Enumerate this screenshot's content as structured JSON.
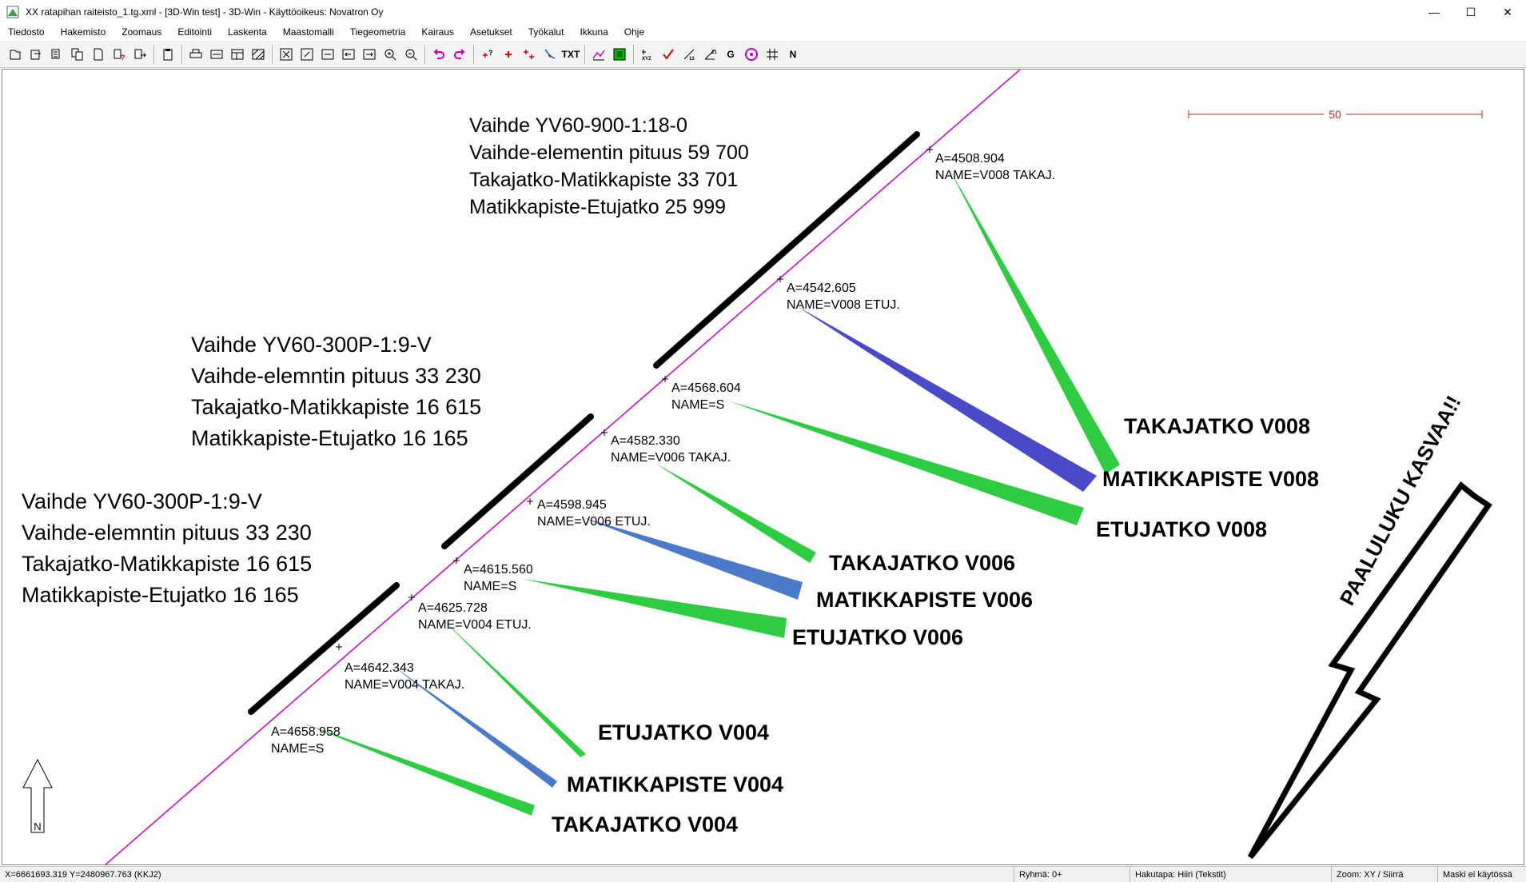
{
  "window": {
    "title": "XX ratapihan raiteisto_1.tg.xml - [3D-Win test] - 3D-Win - Käyttöoikeus: Novatron Oy",
    "minimize": "—",
    "maximize": "☐",
    "close": "✕"
  },
  "menu": [
    "Tiedosto",
    "Hakemisto",
    "Zoomaus",
    "Editointi",
    "Laskenta",
    "Maastomalli",
    "Tiegeometria",
    "Kairaus",
    "Asetukset",
    "Työkalut",
    "Ikkuna",
    "Ohje"
  ],
  "toolbar": {
    "txt": "TXT",
    "g": "G",
    "n": "N"
  },
  "drawing": {
    "scale_label": "50",
    "north_label": "N",
    "direction_text": "PAALULUKU KASVAA!!",
    "v008_info": [
      "Vaihde YV60-900-1:18-0",
      "Vaihde-elementin pituus 59 700",
      "Takajatko-Matikkapiste 33 701",
      "Matikkapiste-Etujatko 25 999"
    ],
    "v006_info": [
      "Vaihde YV60-300P-1:9-V",
      "Vaihde-elemntin pituus 33 230",
      "Takajatko-Matikkapiste 16 615",
      "Matikkapiste-Etujatko 16 165"
    ],
    "v004_info": [
      "Vaihde YV60-300P-1:9-V",
      "Vaihde-elemntin pituus 33 230",
      "Takajatko-Matikkapiste 16 615",
      "Matikkapiste-Etujatko 16 165"
    ],
    "points": [
      {
        "a": "A=4508.904",
        "name": "NAME=V008 TAKAJ."
      },
      {
        "a": "A=4542.605",
        "name": "NAME=V008 ETUJ."
      },
      {
        "a": "A=4568.604",
        "name": "NAME=S"
      },
      {
        "a": "A=4582.330",
        "name": "NAME=V006 TAKAJ."
      },
      {
        "a": "A=4598.945",
        "name": "NAME=V006 ETUJ."
      },
      {
        "a": "A=4615.560",
        "name": "NAME=S"
      },
      {
        "a": "A=4625.728",
        "name": "NAME=V004 ETUJ."
      },
      {
        "a": "A=4642.343",
        "name": "NAME=V004 TAKAJ."
      },
      {
        "a": "A=4658.958",
        "name": "NAME=S"
      }
    ],
    "callouts": {
      "takajatko_v008": "TAKAJATKO V008",
      "matikkapiste_v008": "MATIKKAPISTE V008",
      "etujatko_v008": "ETUJATKO V008",
      "takajatko_v006": "TAKAJATKO V006",
      "matikkapiste_v006": "MATIKKAPISTE V006",
      "etujatko_v006": "ETUJATKO V006",
      "etujatko_v004": "ETUJATKO V004",
      "matikkapiste_v004": "MATIKKAPISTE V004",
      "takajatko_v004": "TAKAJATKO V004"
    },
    "colors": {
      "track": "#cc00cc",
      "green": "#2ecc40",
      "blue": "#4a4ac8",
      "mid_blue": "#4a7ac8",
      "scale": "#cc2222"
    }
  },
  "status": {
    "coords": "X=6661693.319  Y=2480967.763   (KKJ2)",
    "group": "Ryhmä: 0+",
    "snap": "Hakutapa: Hiiri (Tekstit)",
    "zoom": "Zoom: XY  /  Siirrä",
    "mask": "Maski ei käytössä"
  }
}
